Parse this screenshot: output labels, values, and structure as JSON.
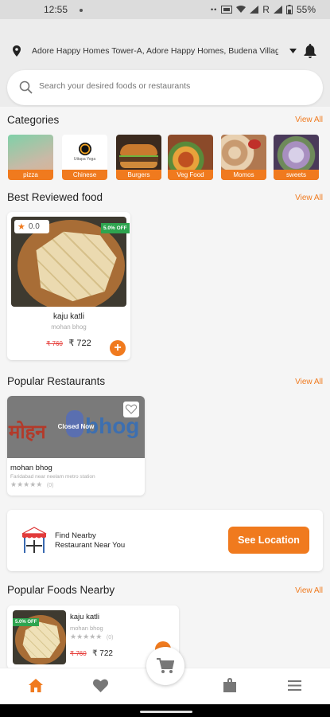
{
  "status_bar": {
    "time": "12:55",
    "battery": "55%",
    "carrier_letter": "R"
  },
  "location": {
    "address": "Adore Happy Homes Tower-A, Adore Happy Homes, Budena Village, ..."
  },
  "search": {
    "placeholder": "Search your desired foods or restaurants"
  },
  "categories": {
    "title": "Categories",
    "view_all": "View All",
    "items": [
      {
        "label": "pizza"
      },
      {
        "label": "Chinese",
        "logo_text": "Uttapa Yoga"
      },
      {
        "label": "Burgers"
      },
      {
        "label": "Veg Food"
      },
      {
        "label": "Momos"
      },
      {
        "label": "sweets"
      }
    ]
  },
  "best_reviewed": {
    "title": "Best Reviewed food",
    "view_all": "View All",
    "items": [
      {
        "rating": "0.0",
        "discount": "5.0% OFF",
        "name": "kaju katli",
        "restaurant": "mohan bhog",
        "old_price": "₹ 760",
        "price": "₹ 722"
      }
    ]
  },
  "popular_restaurants": {
    "title": "Popular Restaurants",
    "view_all": "View All",
    "items": [
      {
        "name": "mohan bhog",
        "address": "Faridabad near neelam metro station",
        "status": "Closed Now",
        "logo_left": "मोहन",
        "logo_right": "bhog",
        "reviews": "(0)"
      }
    ]
  },
  "nearby_banner": {
    "line1": "Find Nearby",
    "line2": "Restaurant Near You",
    "button": "See Location"
  },
  "popular_foods": {
    "title": "Popular Foods Nearby",
    "view_all": "View All",
    "items": [
      {
        "name": "kaju katli",
        "restaurant": "mohan bhog",
        "discount": "5.0% OFF",
        "reviews": "(0)",
        "old_price": "₹ 760",
        "price": "₹ 722"
      }
    ]
  },
  "colors": {
    "accent": "#f07a1e",
    "background": "#f5f5f5"
  }
}
